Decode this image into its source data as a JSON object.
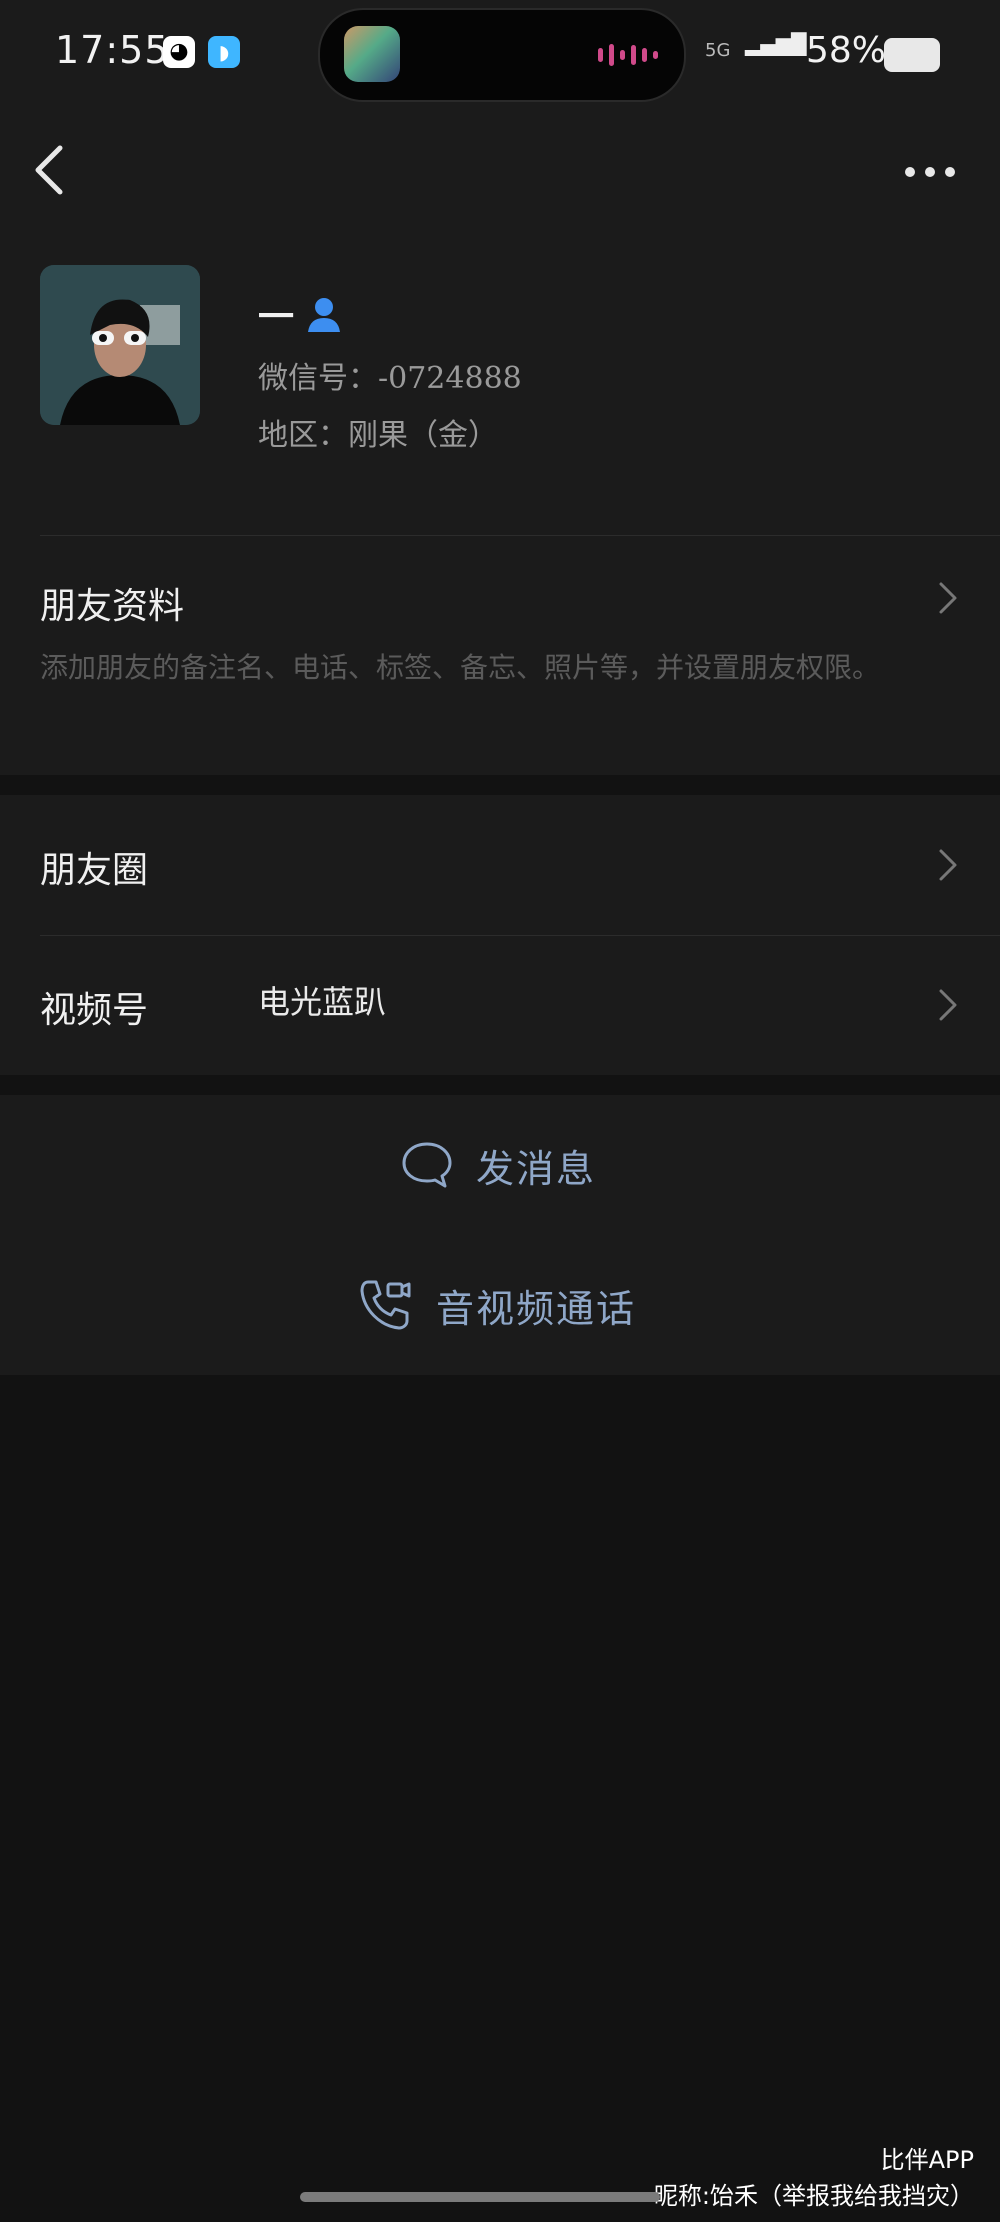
{
  "status_bar": {
    "time": "17:55",
    "app_icon_1": "qq-penguin-icon",
    "app_icon_2": "bird-app-icon",
    "network": "5G",
    "signal_label": "5G",
    "battery": "58%"
  },
  "header": {
    "back_icon": "chevron-left-icon",
    "more_icon": "more-dots-icon"
  },
  "profile": {
    "name": "一",
    "gender_icon": "person-icon",
    "wechat_id": "微信号：-0724888",
    "region": "地区：刚果（金）"
  },
  "friend_info": {
    "title": "朋友资料",
    "description": "添加朋友的备注名、电话、标签、备忘、照片等，并设置朋友权限。"
  },
  "moments": {
    "title": "朋友圈"
  },
  "channels": {
    "title": "视频号",
    "value": "电光蓝趴"
  },
  "actions": {
    "message": "发消息",
    "call": "音视频通话"
  },
  "watermark": {
    "line1": "比伴APP",
    "line2": "昵称:饴禾（举报我给我挡灾）"
  },
  "colors": {
    "background": "#121212",
    "card": "#1b1b1b",
    "action_text": "#8fa7c8",
    "gender_icon": "#3d8ef0"
  }
}
